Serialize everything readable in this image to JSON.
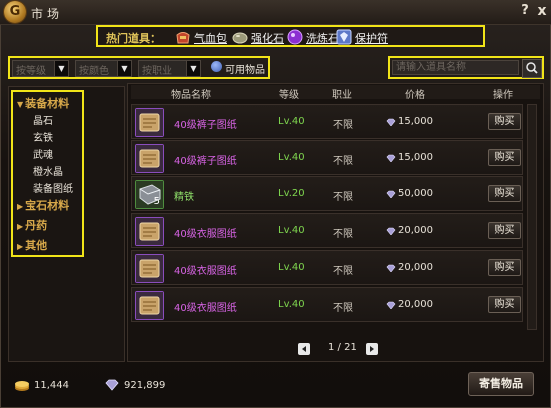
{
  "window": {
    "title": "市场",
    "logo_char": "G",
    "help_label": "?",
    "close_label": "x"
  },
  "hot_items": {
    "label": "热门道具：",
    "items": [
      {
        "name": "气血包",
        "icon": "blood-pack-icon",
        "color": "#c2452a"
      },
      {
        "name": "强化石",
        "icon": "enhance-stone-icon",
        "color": "#9c9a7a"
      },
      {
        "name": "洗炼石",
        "icon": "refine-stone-icon",
        "color": "#8b2fd1"
      },
      {
        "name": "保护符",
        "icon": "protect-charm-icon",
        "color": "#5d78c8"
      }
    ]
  },
  "filters": {
    "level": "按等级",
    "color": "按颜色",
    "job": "按职业",
    "usable_label": "可用物品",
    "search_placeholder": "请输入道具名称"
  },
  "categories": [
    {
      "label": "装备材料",
      "expanded": true,
      "children": [
        "晶石",
        "玄铁",
        "武魂",
        "橙水晶",
        "装备图纸"
      ]
    },
    {
      "label": "宝石材料",
      "expanded": false
    },
    {
      "label": "丹药",
      "expanded": false
    },
    {
      "label": "其他",
      "expanded": false
    }
  ],
  "table": {
    "headers": [
      "物品名称",
      "等级",
      "职业",
      "价格",
      "操作"
    ],
    "buy_label": "购买",
    "rows": [
      {
        "name": "40级裤子图纸",
        "level": "Lv.40",
        "job": "不限",
        "price": "15,000",
        "rarity": "purple",
        "icon": "scroll-icon"
      },
      {
        "name": "40级裤子图纸",
        "level": "Lv.40",
        "job": "不限",
        "price": "15,000",
        "rarity": "purple",
        "icon": "scroll-icon"
      },
      {
        "name": "精铁",
        "level": "Lv.20",
        "job": "不限",
        "price": "50,000",
        "rarity": "green",
        "icon": "iron-ingot-icon",
        "qty": "5"
      },
      {
        "name": "40级衣服图纸",
        "level": "Lv.40",
        "job": "不限",
        "price": "20,000",
        "rarity": "purple",
        "icon": "scroll-icon"
      },
      {
        "name": "40级衣服图纸",
        "level": "Lv.40",
        "job": "不限",
        "price": "20,000",
        "rarity": "purple",
        "icon": "scroll-icon"
      },
      {
        "name": "40级衣服图纸",
        "level": "Lv.40",
        "job": "不限",
        "price": "20,000",
        "rarity": "purple",
        "icon": "scroll-icon"
      }
    ]
  },
  "pager": {
    "text": "1 / 21"
  },
  "footer": {
    "gold": "11,444",
    "gems": "921,899",
    "sell_label": "寄售物品"
  },
  "colors": {
    "highlight": "#f1e418",
    "rare_purple": "#d864e5",
    "common_green": "#8fe06a",
    "level_green": "#7fd64f"
  }
}
